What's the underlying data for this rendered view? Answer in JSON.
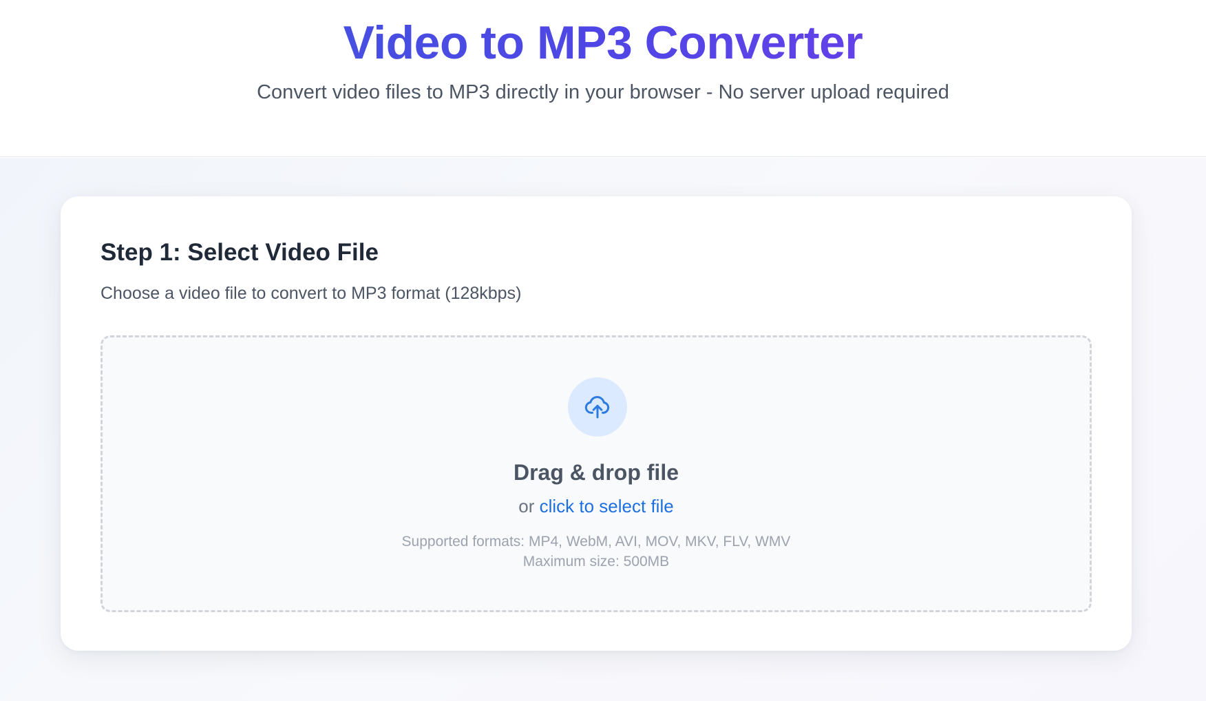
{
  "header": {
    "title": "Video to MP3 Converter",
    "subtitle": "Convert video files to MP3 directly in your browser - No server upload required"
  },
  "step1": {
    "title": "Step 1: Select Video File",
    "description": "Choose a video file to convert to MP3 format (128kbps)"
  },
  "dropzone": {
    "icon": "cloud-upload-icon",
    "title": "Drag & drop file",
    "or_text": "or ",
    "link_text": "click to select file",
    "formats": "Supported formats: MP4, WebM, AVI, MOV, MKV, FLV, WMV",
    "max_size": "Maximum size: 500MB"
  },
  "colors": {
    "title_gradient_start": "#3b5bdb",
    "title_gradient_end": "#7c3aed",
    "link": "#1d6fe0",
    "icon": "#2b7be0",
    "icon_bg": "#dbeafe"
  }
}
